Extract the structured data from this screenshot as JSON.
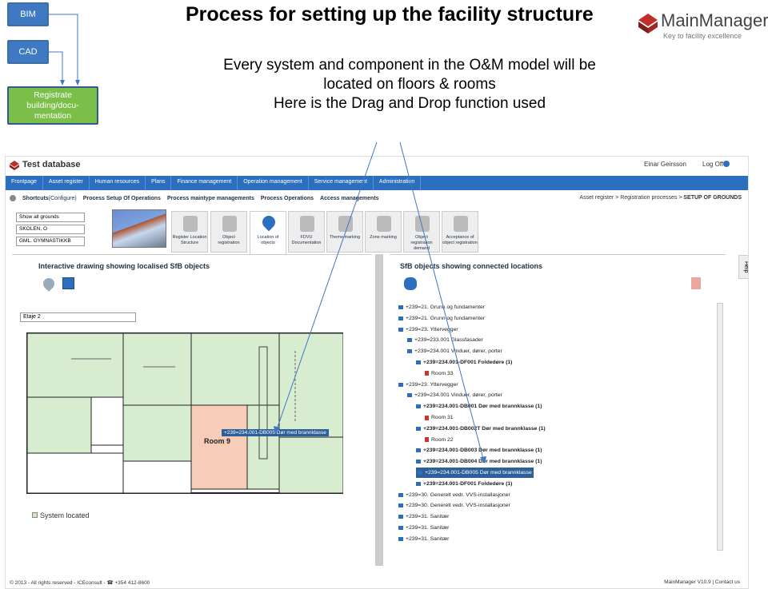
{
  "flow": {
    "bim": "BIM",
    "cad": "CAD",
    "registrate": "Registrate building/docu-mentation"
  },
  "slide": {
    "title": "Process for setting up the facility structure",
    "subtitle_line1": "Every system and component in the O&M model will be",
    "subtitle_line2": "located on floors & rooms",
    "subtitle_line3": "Here is the Drag and Drop function used"
  },
  "logo": {
    "name": "MainManager",
    "tagline": "Key to facility excellence"
  },
  "app": {
    "title": "Test database",
    "user": "Einar Geirsson",
    "logoff": "Log Off",
    "nav": [
      "Frontpage",
      "Asset register",
      "Human resources",
      "Plans",
      "Finance management",
      "Operation management",
      "Service management",
      "Administration"
    ],
    "shortcuts_label": "Shortcuts",
    "shortcuts_configure": "(Configure)",
    "shortcuts": [
      "Process Setup Of Operations",
      "Process maintype managements",
      "Process Operations",
      "Access managements"
    ],
    "breadcrumb": {
      "a": "Asset register",
      "b": "Registration processes",
      "sep": ">",
      "c": "SETUP OF GROUNDS"
    },
    "filters": {
      "grounds": "Show all grounds",
      "site": "SKOLEN, O",
      "building": "GML. GYMNASTIKKB"
    },
    "tabs": [
      "Register Location Structure",
      "Object registration",
      "Location of objects",
      "FDVU Documentation",
      "Theme marking",
      "Zone marking",
      "Object registration demand",
      "Acceptance of object registration"
    ],
    "help": "Help",
    "left_panel_title": "Interactive drawing showing localised SfB objects",
    "right_panel_title": "SfB objects showing connected locations",
    "floor": "Etaje 2",
    "legend": "System located",
    "room_label": "Room 9",
    "drag_label": "+239=234.001-DB005 Dør med brannklasse",
    "footer_left": "© 2013 - All rights reserved - ICEconsult - ☎ +354 412-8600",
    "footer_right": "MainManager V10.9 | Contact us"
  },
  "tree": [
    {
      "text": "+239=21. Grunn og fundamenter",
      "indent": 0,
      "bold": false,
      "room": false,
      "hl": false
    },
    {
      "text": "+239=21. Grunn og fundamenter",
      "indent": 0,
      "bold": false,
      "room": false,
      "hl": false
    },
    {
      "text": "+239=23. Yttervegger",
      "indent": 0,
      "bold": false,
      "room": false,
      "hl": false
    },
    {
      "text": "+239=233.001 Glassfasader",
      "indent": 1,
      "bold": false,
      "room": false,
      "hl": false
    },
    {
      "text": "+239=234.001 Vinduer, dører, porter",
      "indent": 1,
      "bold": false,
      "room": false,
      "hl": false
    },
    {
      "text": "+239=234.001-DF001 Foldedøre (1)",
      "indent": 2,
      "bold": true,
      "room": false,
      "hl": false
    },
    {
      "text": "Room 33",
      "indent": 3,
      "bold": false,
      "room": true,
      "hl": false
    },
    {
      "text": "+239=23. Yttervegger",
      "indent": 0,
      "bold": false,
      "room": false,
      "hl": false
    },
    {
      "text": "+239=234.001 Vinduer, dører, porter",
      "indent": 1,
      "bold": false,
      "room": false,
      "hl": false
    },
    {
      "text": "+239=234.001-DB001 Dør med brannklasse (1)",
      "indent": 2,
      "bold": true,
      "room": false,
      "hl": false
    },
    {
      "text": "Room 31",
      "indent": 3,
      "bold": false,
      "room": true,
      "hl": false
    },
    {
      "text": "+239=234.001-DB002T Dør med brannklasse (1)",
      "indent": 2,
      "bold": true,
      "room": false,
      "hl": false
    },
    {
      "text": "Room 22",
      "indent": 3,
      "bold": false,
      "room": true,
      "hl": false
    },
    {
      "text": "+239=234.001-DB003 Dør med brannklasse (1)",
      "indent": 2,
      "bold": true,
      "room": false,
      "hl": false
    },
    {
      "text": "+239=234.001-DB004 Dør med brannklasse (1)",
      "indent": 2,
      "bold": true,
      "room": false,
      "hl": false
    },
    {
      "text": "+239=234.001-DB005 Dør med brannklasse",
      "indent": 2,
      "bold": false,
      "room": false,
      "hl": true
    },
    {
      "text": "+239=234.001-DF001 Foldedøre (1)",
      "indent": 2,
      "bold": true,
      "room": false,
      "hl": false
    },
    {
      "text": "+239=30. Generelt vedr. VVS-installasjoner",
      "indent": 0,
      "bold": false,
      "room": false,
      "hl": false
    },
    {
      "text": "+239=30. Generelt vedr. VVS-installasjoner",
      "indent": 0,
      "bold": false,
      "room": false,
      "hl": false
    },
    {
      "text": "+239=31. Sanitær",
      "indent": 0,
      "bold": false,
      "room": false,
      "hl": false
    },
    {
      "text": "+239=31. Sanitær",
      "indent": 0,
      "bold": false,
      "room": false,
      "hl": false
    },
    {
      "text": "+239=31. Sanitær",
      "indent": 0,
      "bold": false,
      "room": false,
      "hl": false
    }
  ]
}
